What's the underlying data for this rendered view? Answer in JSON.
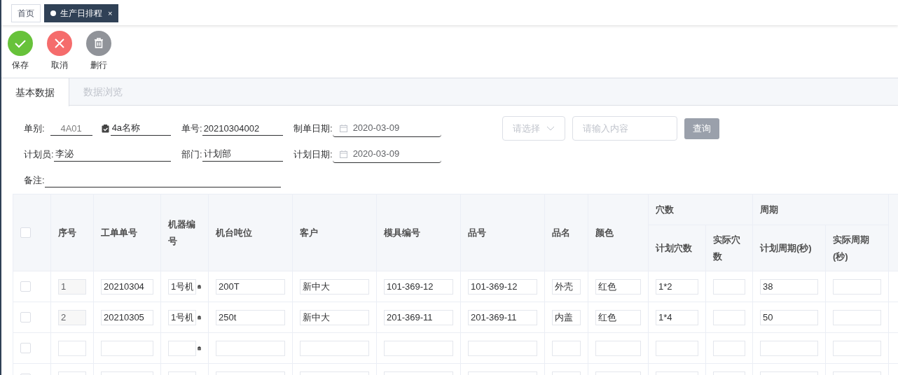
{
  "top_tabs": [
    {
      "label": "首页",
      "selected": false
    },
    {
      "label": "生产日排程",
      "selected": true,
      "close": "×"
    }
  ],
  "toolbar": [
    {
      "kind": "save",
      "label": "保存"
    },
    {
      "kind": "cancel",
      "label": "取消"
    },
    {
      "kind": "delete",
      "label": "删行"
    }
  ],
  "section_tabs": [
    {
      "label": "基本数据",
      "selected": true
    },
    {
      "label": "数据浏览",
      "selected": false
    }
  ],
  "form": {
    "rows": [
      [
        {
          "kind": "lookup",
          "label": "单别:",
          "value": "4A01",
          "name": "4a名称"
        },
        {
          "kind": "text",
          "label": "单号:",
          "value": "20210304002"
        },
        {
          "kind": "date",
          "label": "制单日期:",
          "value": "2020-03-09"
        }
      ],
      [
        {
          "kind": "text",
          "label": "计划员:",
          "value": "李泌"
        },
        {
          "kind": "text",
          "label": "部门:",
          "value": "计划部"
        },
        {
          "kind": "date",
          "label": "计划日期:",
          "value": "2020-03-09"
        }
      ],
      [
        {
          "kind": "text",
          "label": "备注:"
        }
      ]
    ]
  },
  "search": {
    "select_placeholder": "请选择",
    "input_placeholder": "请输入内容",
    "button": "查询"
  },
  "table": {
    "header_checked": false,
    "columns": [
      {
        "label": "序号"
      },
      {
        "label": "工单单号"
      },
      {
        "label": "机器编号"
      },
      {
        "label": "机台吨位"
      },
      {
        "label": "客户"
      },
      {
        "label": "模具编号"
      },
      {
        "label": "品号"
      },
      {
        "label": "品名"
      },
      {
        "label": "颜色"
      },
      {
        "label": "穴数",
        "children": [
          {
            "label": "计划穴数"
          },
          {
            "label": "实际穴数"
          }
        ]
      },
      {
        "label": "周期",
        "children": [
          {
            "label": "计划周期(秒)"
          },
          {
            "label": "实际周期(秒)"
          }
        ]
      }
    ],
    "rows": [
      {
        "kind": "filled",
        "checked": false,
        "cells": [
          "1",
          "20210304",
          "1号机",
          "200T",
          "新中大",
          "101-369-12",
          "101-369-12",
          "外壳",
          "红色",
          "1*2",
          null,
          "38",
          null
        ]
      },
      {
        "kind": "filled",
        "checked": false,
        "cells": [
          "2",
          "20210305",
          "1号机",
          "250t",
          "新中大",
          "201-369-11",
          "201-369-11",
          "内盖",
          "红色",
          "1*4",
          null,
          "50",
          null
        ]
      },
      {
        "kind": "blank",
        "checked": false
      },
      {
        "kind": "blank",
        "checked": false
      }
    ]
  }
}
